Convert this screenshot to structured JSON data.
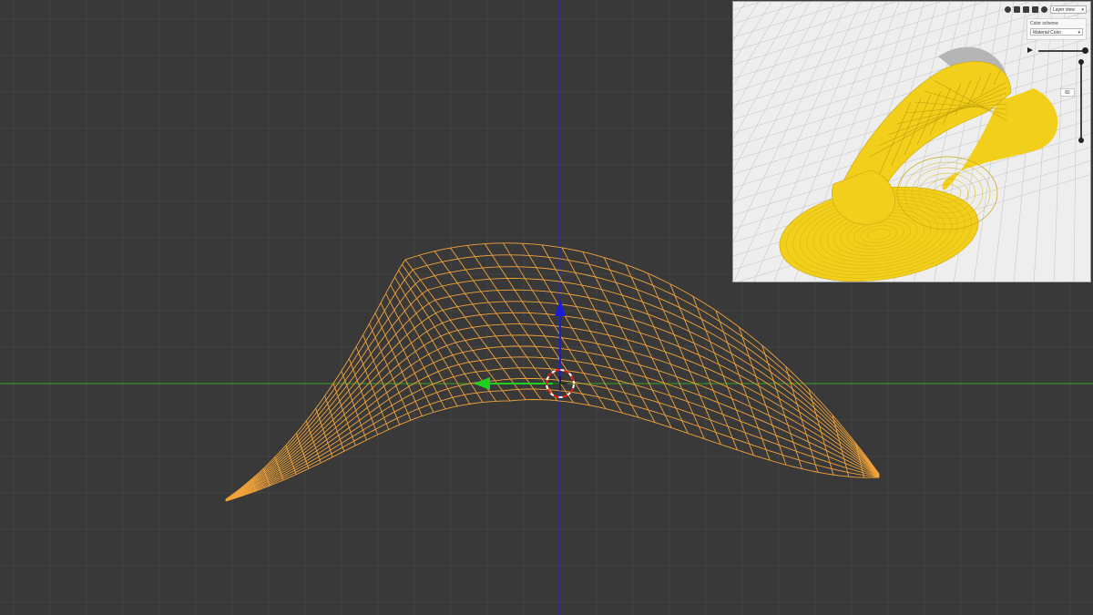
{
  "viewport": {
    "background": "#393939",
    "grid_color": "#444444",
    "wireframe_color": "#f2a33a",
    "x_axis_color": "#3c8c2c",
    "z_axis_color": "#2a2ab4",
    "gizmo_x_color": "#20d020",
    "gizmo_z_color": "#1d1dd9",
    "icons": {
      "mesh": "wireframe-mesh-icon",
      "cursor": "3d-cursor-icon",
      "gizmo": "move-gizmo-icon"
    }
  },
  "inset": {
    "view_select": "Layer view",
    "color_scheme_label": "Color scheme",
    "color_scheme_value": "Material Color",
    "layer_number": "82",
    "print_color": "#f2cf1b",
    "icons": [
      "render-icon",
      "cube-icon",
      "layers-icon",
      "xray-icon",
      "settings-icon"
    ]
  }
}
